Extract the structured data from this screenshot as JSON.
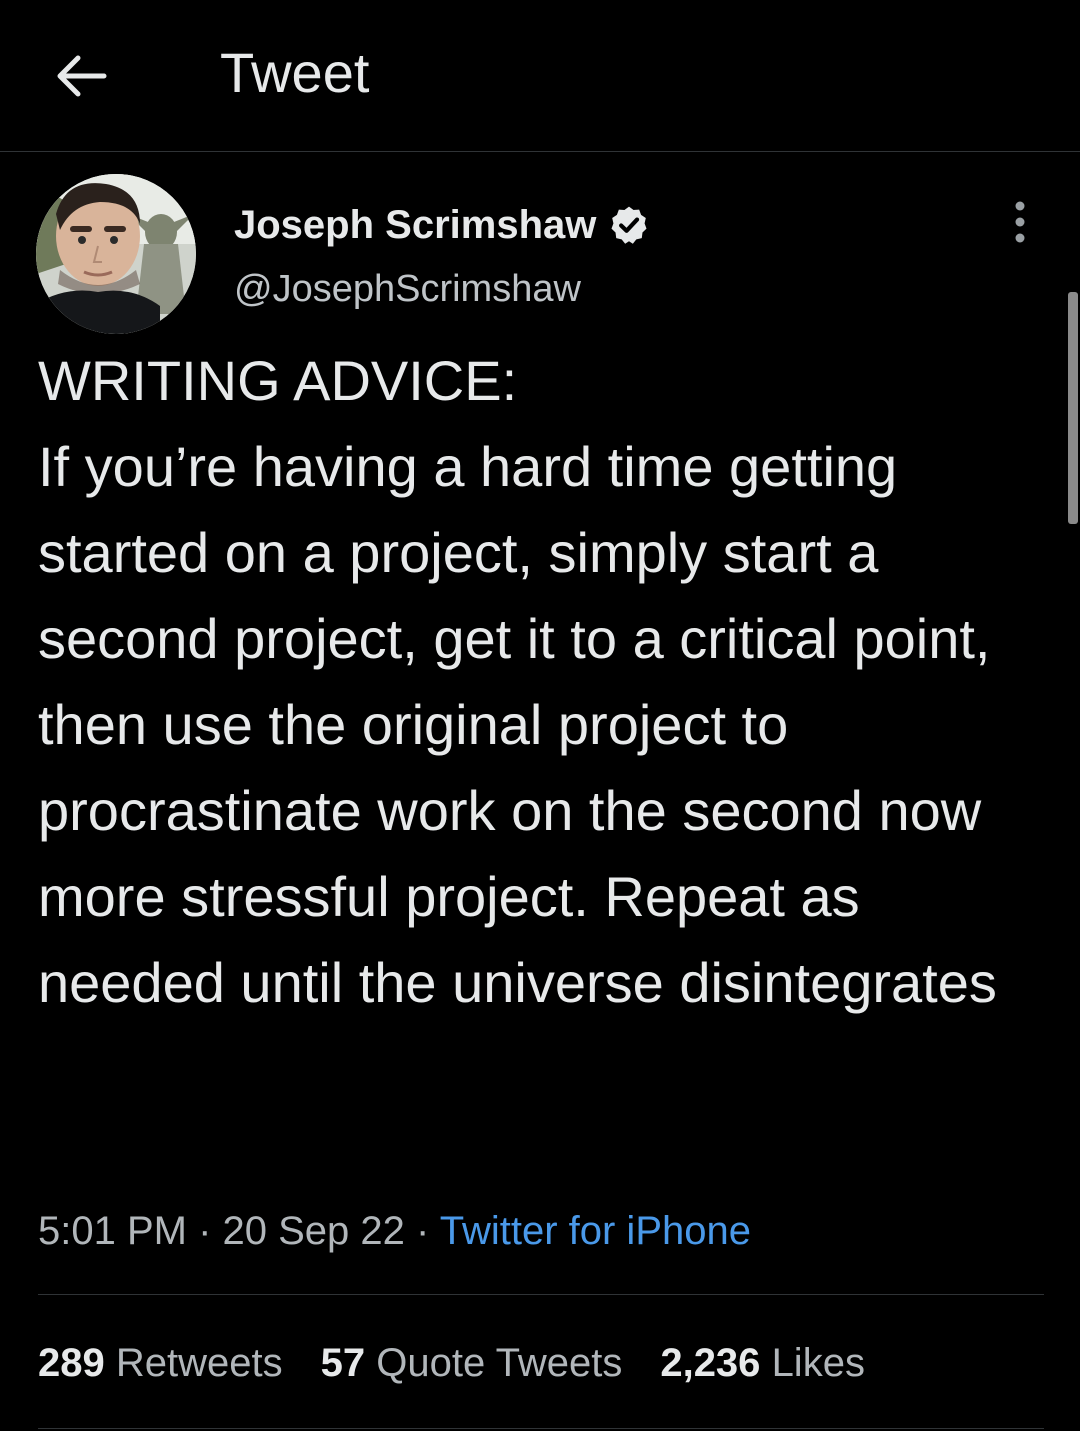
{
  "header": {
    "back_icon": "arrow-left-icon",
    "title": "Tweet"
  },
  "author": {
    "name": "Joseph Scrimshaw",
    "handle": "@JosephScrimshaw",
    "verified_icon": "verified-badge-icon",
    "avatar_icon": "profile-photo"
  },
  "more_icon": "vertical-ellipsis-icon",
  "tweet": {
    "text": "WRITING ADVICE:\nIf you’re having a hard time getting started on a project, simply start a second project, get it to a critical point, then use the original project to procrastinate work on the second now more stressful project. Repeat as needed until the universe disintegrates",
    "time": "5:01 PM",
    "date": "20 Sep 22",
    "source": "Twitter for iPhone",
    "separator": " · "
  },
  "stats": {
    "retweets_count": "289",
    "retweets_label": "Retweets",
    "quotes_count": "57",
    "quotes_label": "Quote Tweets",
    "likes_count": "2,236",
    "likes_label": "Likes"
  },
  "colors": {
    "background": "#000000",
    "text": "#e7e9ea",
    "secondary_text": "#b1b6ba",
    "link": "#4a99e9",
    "divider": "#2f3336"
  }
}
